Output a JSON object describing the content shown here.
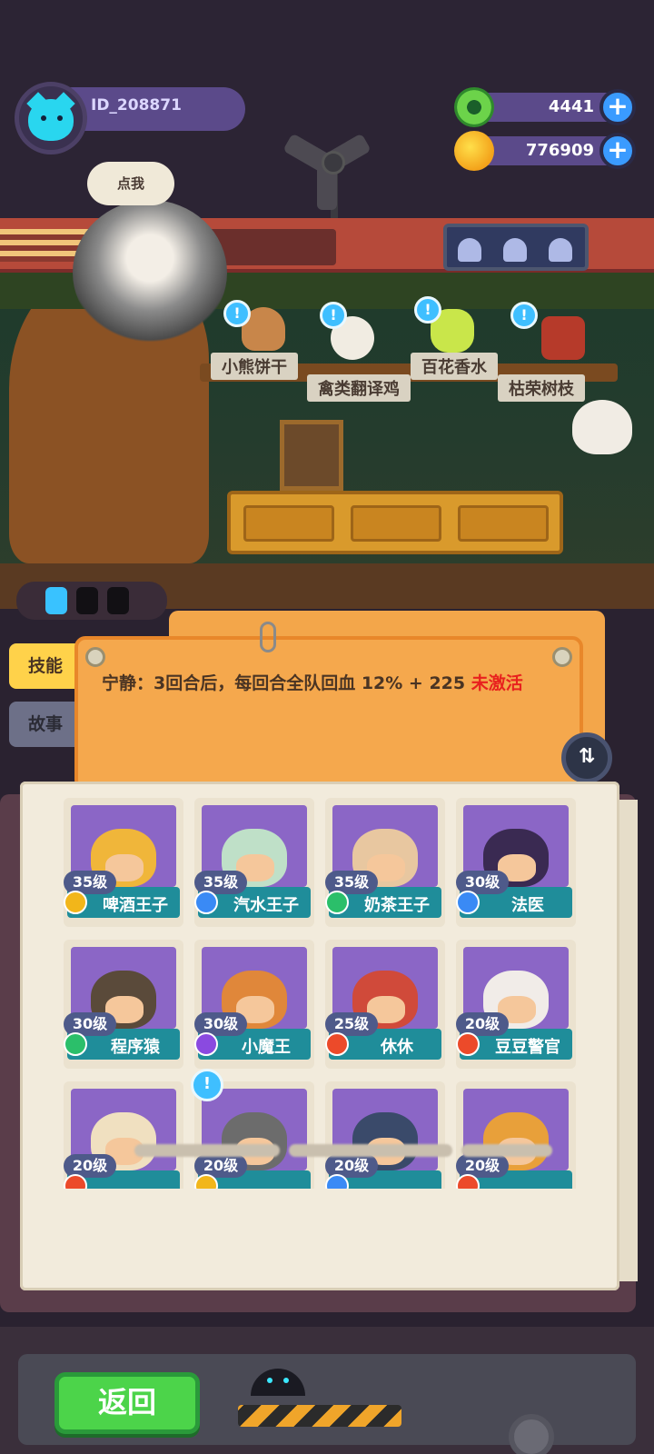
{
  "player": {
    "id_text": "ID_208871"
  },
  "currencies": [
    {
      "name": "green-gem",
      "value": "4441"
    },
    {
      "name": "gold-coin",
      "value": "776909"
    }
  ],
  "shop": {
    "speech": "点我",
    "item_labels": [
      "小熊饼干",
      "禽类翻译鸡",
      "百花香水",
      "枯荣树枝"
    ]
  },
  "energy": {
    "filled": 1,
    "total": 3
  },
  "tabs": {
    "skill": "技能",
    "story": "故事"
  },
  "skill_card": {
    "text": "宁静：3回合后，每回合全队回血 12% + 225 ",
    "status": "未激活"
  },
  "characters": [
    {
      "level": "35级",
      "name": "啤酒王子",
      "badge": "gold",
      "color": "#f0b63a"
    },
    {
      "level": "35级",
      "name": "汽水王子",
      "badge": "blue",
      "color": "#bfe0c8"
    },
    {
      "level": "35级",
      "name": "奶茶王子",
      "badge": "green",
      "color": "#e8c7a0"
    },
    {
      "level": "30级",
      "name": "法医",
      "badge": "blue",
      "color": "#3a2a52"
    },
    {
      "level": "30级",
      "name": "程序猿",
      "badge": "green",
      "color": "#5a4a3a"
    },
    {
      "level": "30级",
      "name": "小魔王",
      "badge": "purple",
      "color": "#e0873a"
    },
    {
      "level": "25级",
      "name": "休休",
      "badge": "red",
      "color": "#d04a3a"
    },
    {
      "level": "20级",
      "name": "豆豆警官",
      "badge": "red",
      "color": "#f1ece8"
    },
    {
      "level": "20级",
      "name": "",
      "badge": "red",
      "color": "#f0e0c0"
    },
    {
      "level": "20级",
      "name": "",
      "badge": "gold",
      "color": "#6c6c6c"
    },
    {
      "level": "20级",
      "name": "",
      "badge": "blue",
      "color": "#3a4a6a"
    },
    {
      "level": "20级",
      "name": "",
      "badge": "red",
      "color": "#e8a03a"
    }
  ],
  "buttons": {
    "back": "返回"
  }
}
